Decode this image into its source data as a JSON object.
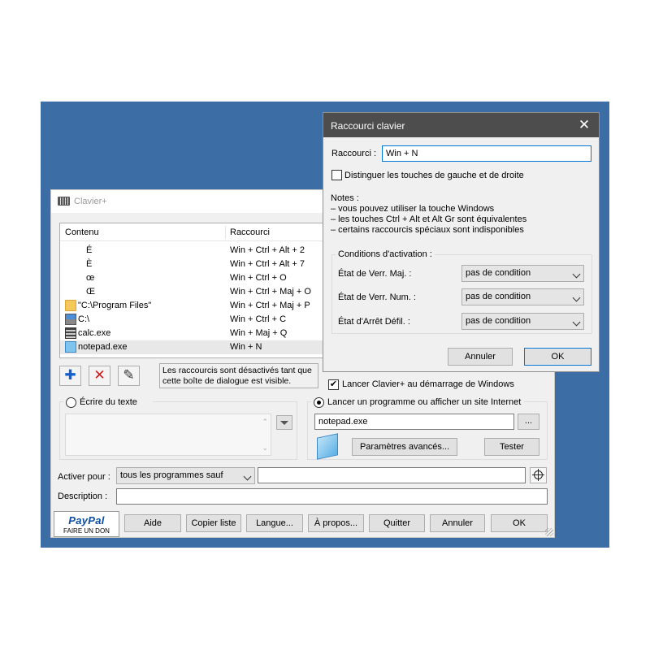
{
  "main_window": {
    "title": "Clavier+",
    "list": {
      "col_content": "Contenu",
      "col_shortcut": "Raccourci",
      "rows": [
        {
          "content": "É",
          "shortcut": "Win + Ctrl + Alt + 2",
          "icon": "none"
        },
        {
          "content": "È",
          "shortcut": "Win + Ctrl + Alt + 7",
          "icon": "none"
        },
        {
          "content": "œ",
          "shortcut": "Win + Ctrl + O",
          "icon": "none"
        },
        {
          "content": "Œ",
          "shortcut": "Win + Ctrl + Maj + O",
          "icon": "none"
        },
        {
          "content": "\"C:\\Program Files\"",
          "shortcut": "Win + Ctrl + Maj + P",
          "icon": "folder-icon"
        },
        {
          "content": "C:\\",
          "shortcut": "Win + Ctrl + C",
          "icon": "drive-icon"
        },
        {
          "content": "calc.exe",
          "shortcut": "Win + Maj + Q",
          "icon": "calculator-icon"
        },
        {
          "content": "notepad.exe",
          "shortcut": "Win + N",
          "icon": "notepad-icon"
        }
      ]
    },
    "toolbar": {
      "add": "✚",
      "delete": "✕",
      "edit": "✎"
    },
    "disabled_note": "Les raccourcis sont désactivés tant que cette boîte de dialogue est visible.",
    "startup_checkbox": "Lancer Clavier+ au démarrage de Windows",
    "write_text_radio": "Écrire du texte",
    "launch_radio": "Lancer un programme ou afficher un site Internet",
    "program_value": "notepad.exe",
    "browse": "...",
    "advanced": "Paramètres avancés...",
    "test": "Tester",
    "activate_label": "Activer pour :",
    "activate_value": "tous les programmes sauf",
    "activate_programs": "",
    "description_label": "Description :",
    "description_value": "",
    "paypal_brand": "PayPal",
    "paypal_donate": "FAIRE UN DON",
    "buttons": {
      "help": "Aide",
      "copy_list": "Copier liste",
      "language": "Langue...",
      "about": "À propos...",
      "quit": "Quitter",
      "cancel": "Annuler",
      "ok": "OK"
    }
  },
  "dialog": {
    "title": "Raccourci clavier",
    "close": "✕",
    "shortcut_label": "Raccourci :",
    "shortcut_value": "Win + N",
    "distinguish": "Distinguer les touches de gauche et de droite",
    "notes": [
      "Notes :",
      "– vous pouvez utiliser la touche Windows",
      "– les touches Ctrl + Alt et Alt Gr sont équivalentes",
      "– certains raccourcis spéciaux sont indisponibles"
    ],
    "conditions_title": "Conditions d'activation :",
    "conditions": [
      {
        "label": "État de Verr. Maj. :",
        "value": "pas de condition"
      },
      {
        "label": "État de Verr. Num. :",
        "value": "pas de condition"
      },
      {
        "label": "État d'Arrêt Défil. :",
        "value": "pas de condition"
      }
    ],
    "cancel": "Annuler",
    "ok": "OK"
  },
  "colors": {
    "desktop": "#3c6ea5",
    "dialog_title": "#4d4d4d",
    "accent": "#0078d7"
  }
}
